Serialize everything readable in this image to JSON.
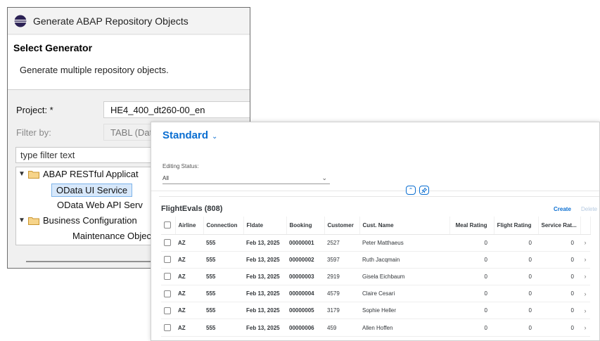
{
  "dialog": {
    "title": "Generate ABAP Repository Objects",
    "heading": "Select Generator",
    "description": "Generate multiple repository objects.",
    "project_label": "Project: *",
    "project_value": "HE4_400_dt260-00_en",
    "filter_label": "Filter by:",
    "filter_value": "TABL (Dat",
    "filter_placeholder": "type filter text",
    "tree": [
      {
        "label": "ABAP RESTful Applicat"
      },
      {
        "label": "OData UI Service"
      },
      {
        "label": "OData Web API Serv"
      },
      {
        "label": "Business Configuration"
      },
      {
        "label": "Maintenance Object"
      }
    ]
  },
  "app": {
    "variant": "Standard",
    "filter": {
      "label": "Editing Status:",
      "value": "All"
    },
    "table": {
      "title": "FlightEvals (808)",
      "create": "Create",
      "delete": "Delete",
      "columns": [
        "Airline",
        "Connection",
        "Fldate",
        "Booking",
        "Customer",
        "Cust. Name",
        "Meal Rating",
        "Flight Rating",
        "Service Rat..."
      ],
      "rows": [
        [
          "AZ",
          "555",
          "Feb 13, 2025",
          "00000001",
          "2527",
          "Peter Matthaeus",
          "0",
          "0",
          "0"
        ],
        [
          "AZ",
          "555",
          "Feb 13, 2025",
          "00000002",
          "3597",
          "Ruth Jacqmain",
          "0",
          "0",
          "0"
        ],
        [
          "AZ",
          "555",
          "Feb 13, 2025",
          "00000003",
          "2919",
          "Gisela Eichbaum",
          "0",
          "0",
          "0"
        ],
        [
          "AZ",
          "555",
          "Feb 13, 2025",
          "00000004",
          "4579",
          "Claire Cesari",
          "0",
          "0",
          "0"
        ],
        [
          "AZ",
          "555",
          "Feb 13, 2025",
          "00000005",
          "3179",
          "Sophie Heller",
          "0",
          "0",
          "0"
        ],
        [
          "AZ",
          "555",
          "Feb 13, 2025",
          "00000006",
          "459",
          "Allen Hoffen",
          "0",
          "0",
          "0"
        ]
      ]
    }
  },
  "colors": {
    "accent": "#0a6ed1",
    "selection": "#d7e8fb",
    "folder": "#e8b64a"
  }
}
